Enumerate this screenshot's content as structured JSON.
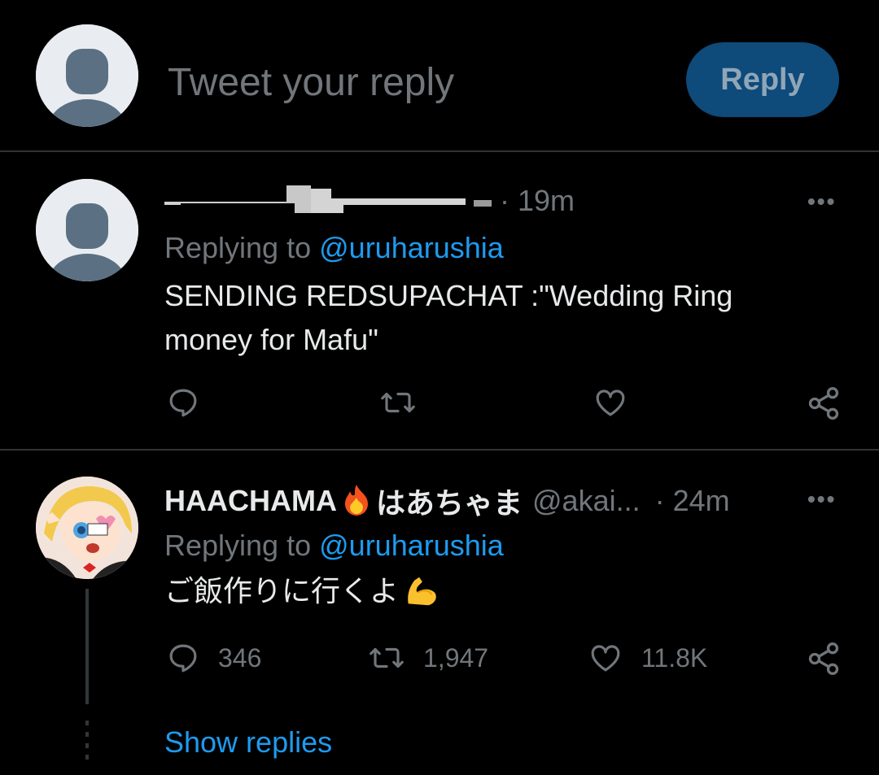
{
  "composer": {
    "placeholder": "Tweet your reply",
    "reply_button": "Reply"
  },
  "tweets": [
    {
      "time": "· 19m",
      "replying_prefix": "Replying to",
      "replying_handle": "@uruharushia",
      "text": "SENDING REDSUPACHAT :\"Wedding Ring money for Mafu\"",
      "actions": {
        "reply": "",
        "retweet": "",
        "like": ""
      }
    },
    {
      "display_name": "HAACHAMA",
      "name_emoji": "fire",
      "name_jp": "はあちゃま",
      "handle": "@akai...",
      "time": "· 24m",
      "replying_prefix": "Replying to",
      "replying_handle": "@uruharushia",
      "text": "ご飯作りに行くよ",
      "text_emoji": "flexed-biceps",
      "actions": {
        "reply": "346",
        "retweet": "1,947",
        "like": "11.8K"
      }
    }
  ],
  "show_replies": "Show replies",
  "colors": {
    "background": "#000000",
    "accent": "#1d9bf0",
    "muted": "#71767b",
    "reply_button_bg": "#0e4a7a",
    "divider": "#2f3336"
  }
}
